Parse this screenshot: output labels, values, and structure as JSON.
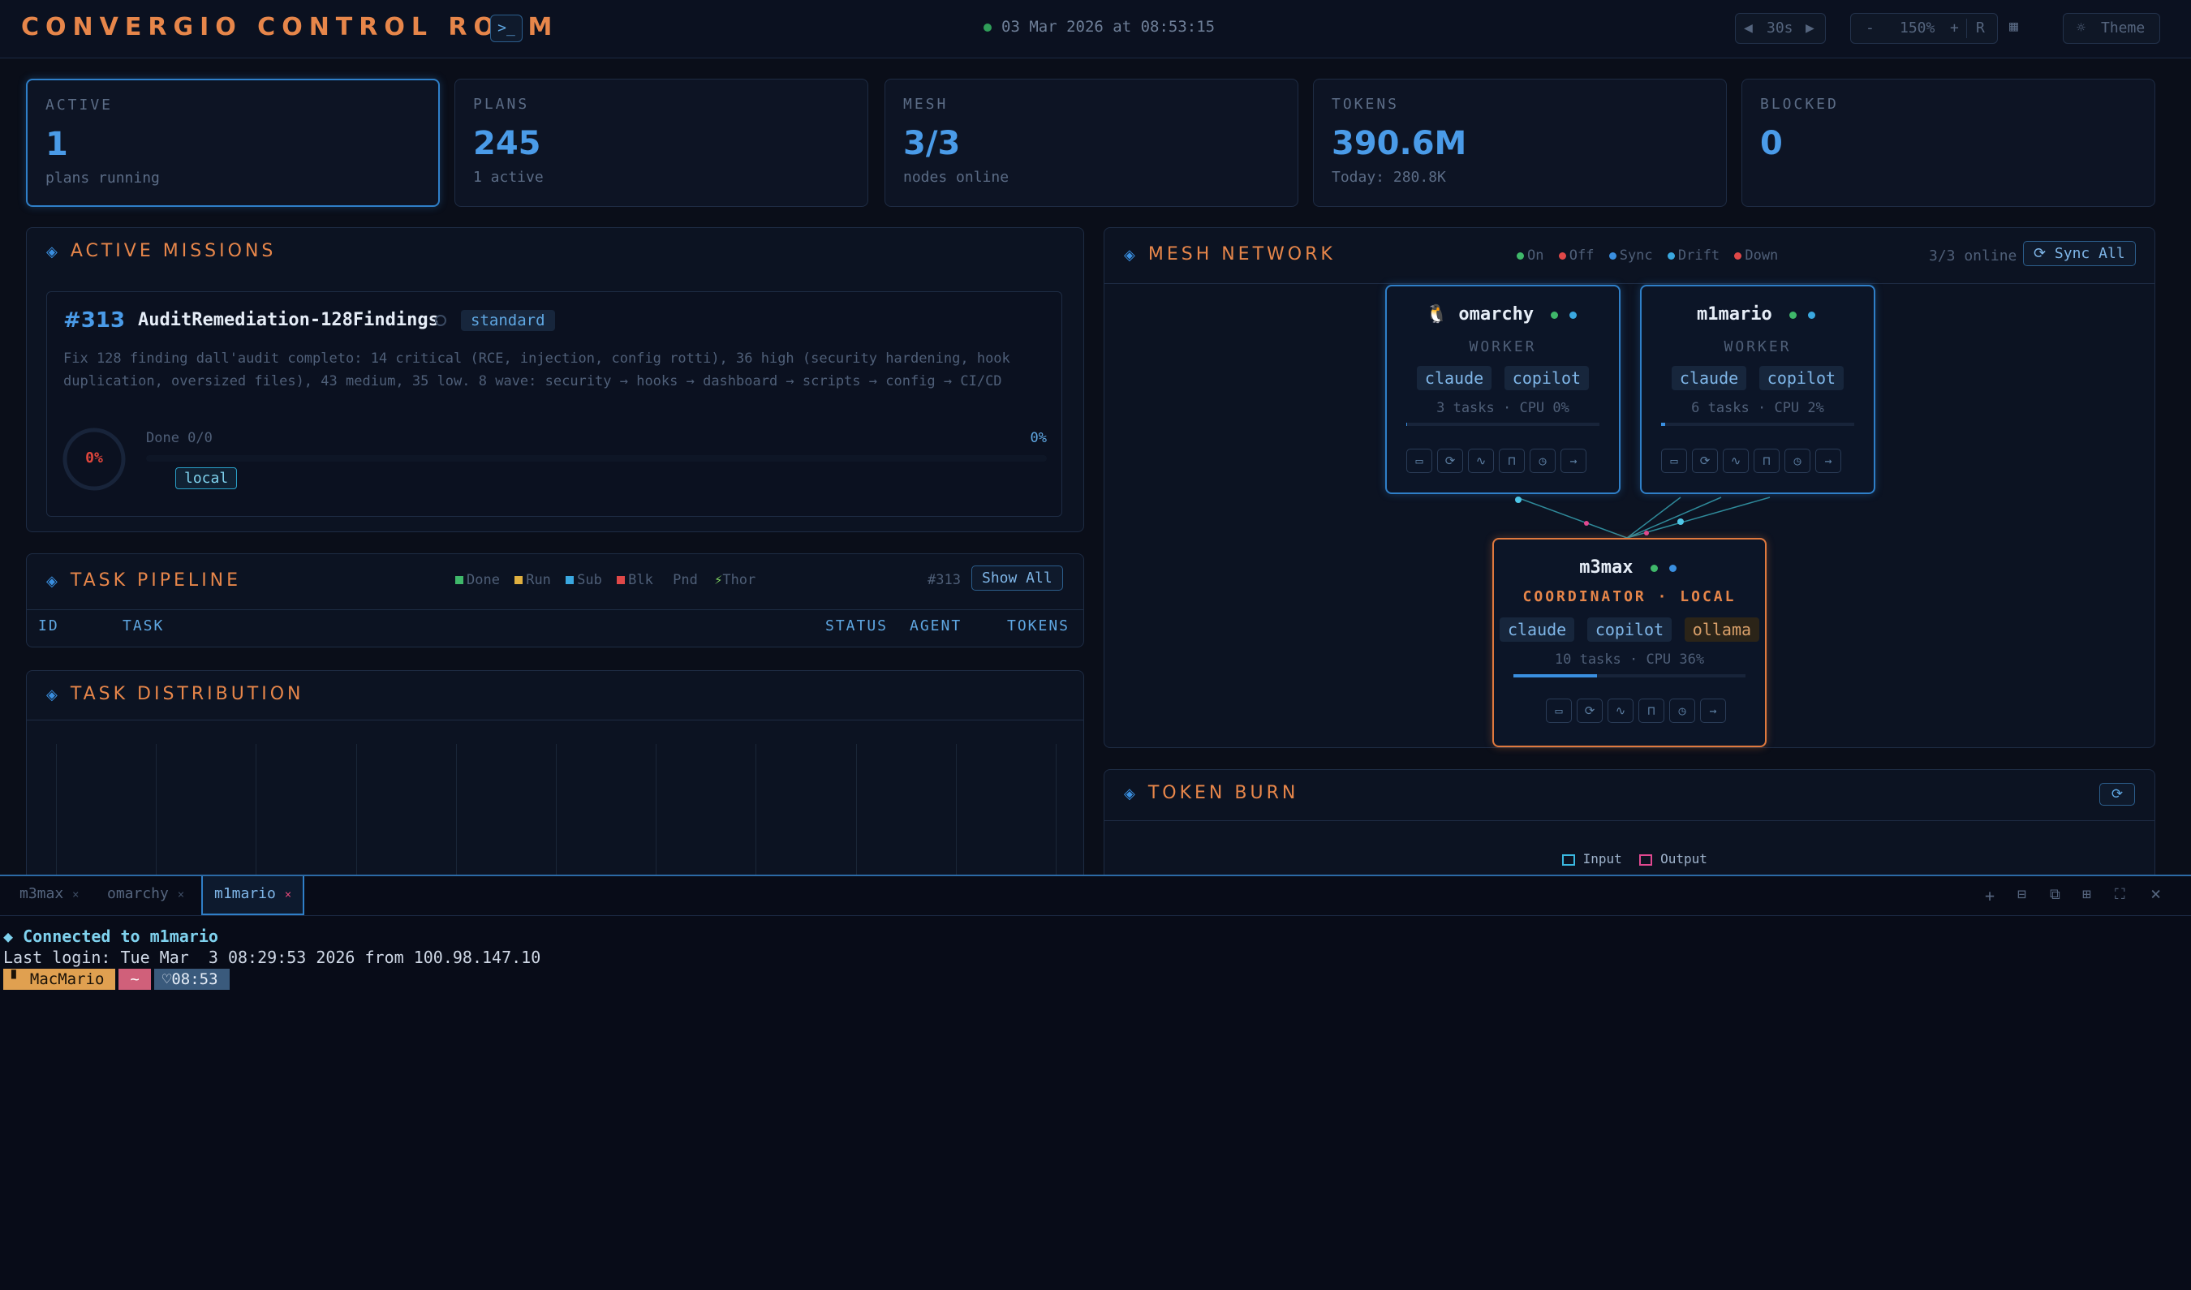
{
  "header": {
    "title": "CONVERGIO CONTROL ROOM",
    "terminal_icon": "terminal-icon",
    "datetime": "03 Mar 2026 at 08:53:15",
    "refresh_prev": "◀",
    "refresh_value": "30s",
    "refresh_next": "▶",
    "zoom_minus": "-",
    "zoom_value": "150%",
    "zoom_plus": "+",
    "zoom_reset": "R",
    "grid_icon": "grid-icon",
    "theme_icon": "sun-icon",
    "theme_label": "Theme"
  },
  "stats": [
    {
      "label": "ACTIVE",
      "value": "1",
      "sub": "plans running"
    },
    {
      "label": "PLANS",
      "value": "245",
      "sub": "1 active"
    },
    {
      "label": "MESH",
      "value": "3/3",
      "sub": "nodes online"
    },
    {
      "label": "TOKENS",
      "value": "390.6M",
      "sub": "Today: 280.8K"
    },
    {
      "label": "BLOCKED",
      "value": "0",
      "sub": ""
    }
  ],
  "missions": {
    "title": "ACTIVE MISSIONS",
    "id": "#313",
    "name": "AuditRemediation-128Findings",
    "badge": "standard",
    "description": "Fix 128 finding dall'audit completo: 14 critical (RCE, injection, config rotti), 36 high (security hardening, hook duplication, oversized files), 43 medium, 35 low. 8 wave: security → hooks → dashboard → scripts → config → CI/CD",
    "progress_text": "0%",
    "done_label": "Done 0/0",
    "progress_pct": "0%",
    "progress": 0,
    "tag": "local"
  },
  "pipeline": {
    "title": "TASK PIPELINE",
    "legend": [
      {
        "label": "Done",
        "color": "#3fb86a"
      },
      {
        "label": "Run",
        "color": "#e0b040"
      },
      {
        "label": "Sub",
        "color": "#3aa8e0"
      },
      {
        "label": "Blk",
        "color": "#e04848"
      },
      {
        "label": "Pnd",
        "color": ""
      },
      {
        "label": "Thor",
        "color": "#7fd060"
      }
    ],
    "plan_ref": "#313",
    "show_all": "Show All",
    "columns": [
      "ID",
      "TASK",
      "STATUS",
      "AGENT",
      "TOKENS"
    ]
  },
  "distribution": {
    "title": "TASK DISTRIBUTION"
  },
  "mesh": {
    "title": "MESH NETWORK",
    "legend": [
      {
        "label": "On",
        "color": "#3fb86a"
      },
      {
        "label": "Off",
        "color": "#e04848"
      },
      {
        "label": "Sync",
        "color": "#3a8fe0"
      },
      {
        "label": "Drift",
        "color": "#3aa8e0"
      },
      {
        "label": "Down",
        "color": "#e04848"
      }
    ],
    "online": "3/3 online",
    "sync_all": "Sync All",
    "nodes": [
      {
        "name": "omarchy",
        "os_icon": "linux-icon",
        "role": "WORKER",
        "tools": [
          "claude",
          "copilot"
        ],
        "stats": "3 tasks · CPU 0%",
        "load": 0
      },
      {
        "name": "m1mario",
        "os_icon": "apple-icon",
        "role": "WORKER",
        "tools": [
          "claude",
          "copilot"
        ],
        "stats": "6 tasks · CPU 2%",
        "load": 0.02
      },
      {
        "name": "m3max",
        "os_icon": "apple-icon",
        "role": "COORDINATOR · LOCAL",
        "tools": [
          "claude",
          "copilot",
          "ollama"
        ],
        "stats": "10 tasks · CPU 36%",
        "load": 0.36
      }
    ]
  },
  "token_burn": {
    "title": "TOKEN BURN",
    "legend_input": "Input",
    "legend_output": "Output"
  },
  "terminal": {
    "tabs": [
      "m3max",
      "omarchy",
      "m1mario"
    ],
    "active_tab": "m1mario",
    "line1": "◆ Connected to m1mario",
    "line2": "Last login: Tue Mar  3 08:29:53 2026 from 100.98.147.10",
    "prompt_host": "MacMario",
    "prompt_dir": "~",
    "prompt_time": "08:53"
  }
}
